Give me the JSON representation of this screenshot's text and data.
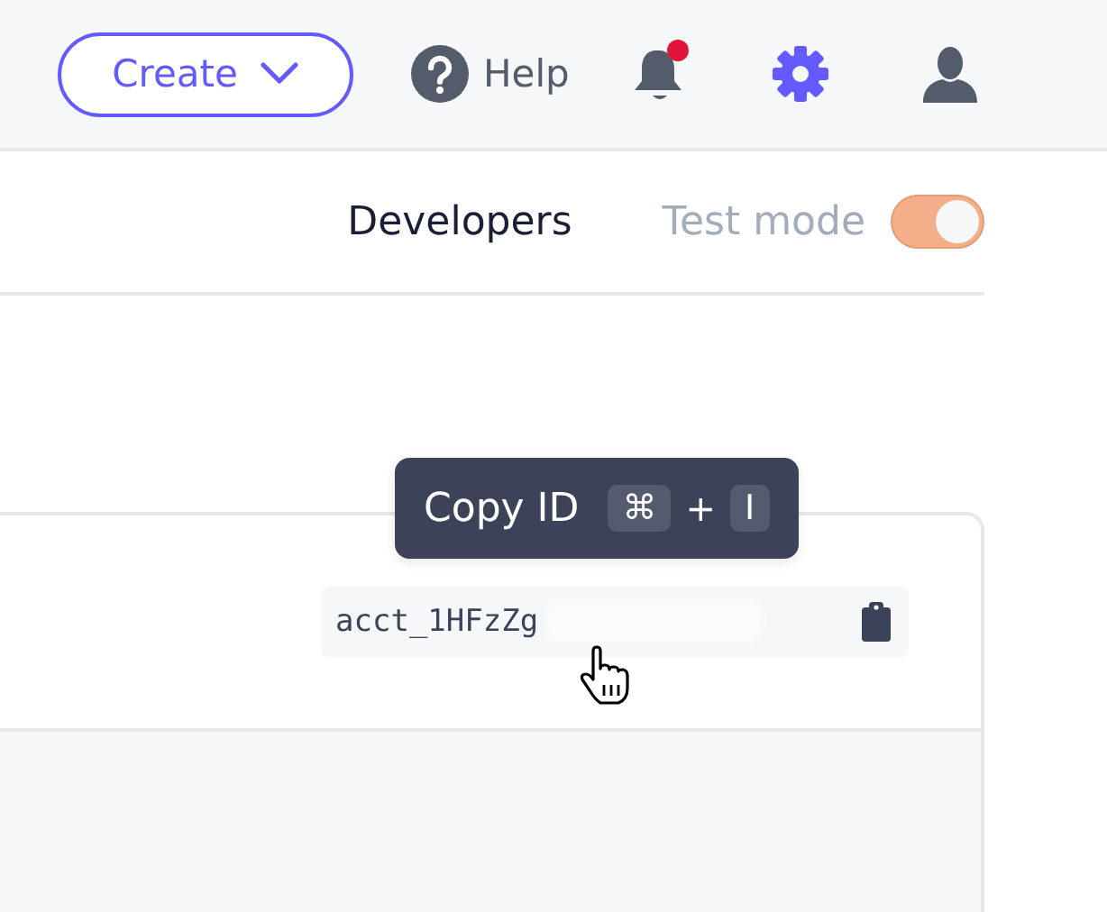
{
  "header": {
    "create_button": "Create",
    "help_link": "Help",
    "notifications_unread": true
  },
  "subheader": {
    "developers_link": "Developers",
    "test_mode_label": "Test mode",
    "test_mode_on": true
  },
  "account_card": {
    "account_id": "acct_1HFzZg",
    "id_redacted": true
  },
  "tooltip": {
    "text": "Copy ID",
    "keys": [
      {
        "label": "⌘",
        "kind": "key"
      },
      {
        "label": "+",
        "kind": "plus"
      },
      {
        "label": "I",
        "kind": "key"
      }
    ]
  }
}
